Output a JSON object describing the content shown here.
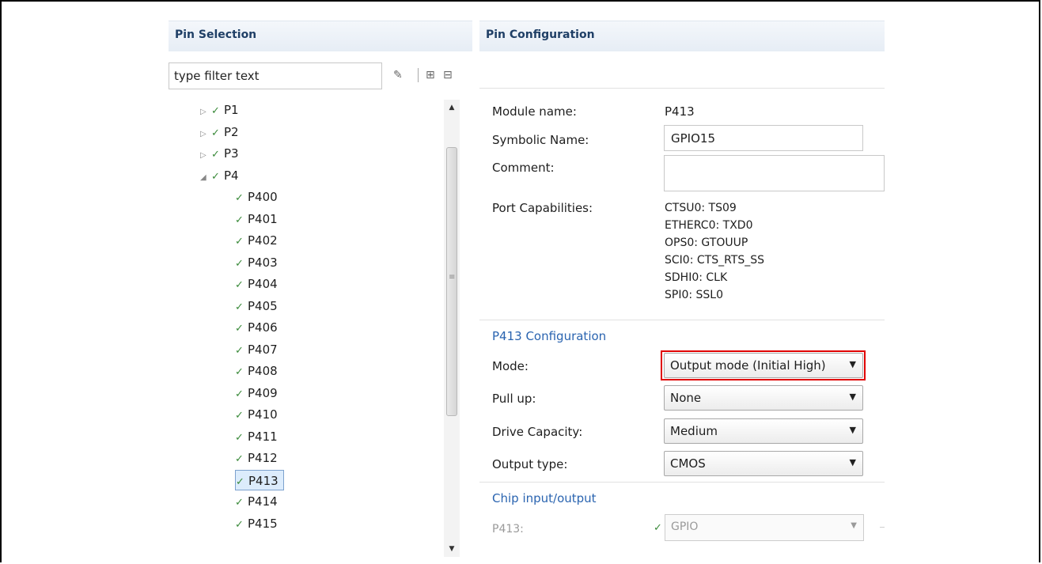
{
  "pin_selection": {
    "title": "Pin Selection",
    "filter_placeholder": "type filter text",
    "tree": [
      {
        "label": "P1",
        "expander": "▷",
        "checked": true
      },
      {
        "label": "P2",
        "expander": "▷",
        "checked": true
      },
      {
        "label": "P3",
        "expander": "▷",
        "checked": true
      },
      {
        "label": "P4",
        "expander": "◢",
        "checked": true
      },
      {
        "label": "P400",
        "checked": true
      },
      {
        "label": "P401",
        "checked": true
      },
      {
        "label": "P402",
        "checked": true
      },
      {
        "label": "P403",
        "checked": true
      },
      {
        "label": "P404",
        "checked": true
      },
      {
        "label": "P405",
        "checked": true
      },
      {
        "label": "P406",
        "checked": true
      },
      {
        "label": "P407",
        "checked": true
      },
      {
        "label": "P408",
        "checked": true
      },
      {
        "label": "P409",
        "checked": true
      },
      {
        "label": "P410",
        "checked": true
      },
      {
        "label": "P411",
        "checked": true
      },
      {
        "label": "P412",
        "checked": true
      },
      {
        "label": "P413",
        "checked": true,
        "selected": true
      },
      {
        "label": "P414",
        "checked": true
      },
      {
        "label": "P415",
        "checked": true
      }
    ]
  },
  "pin_configuration": {
    "title": "Pin Configuration",
    "module_name_label": "Module name:",
    "module_name_value": "P413",
    "symbolic_name_label": "Symbolic Name:",
    "symbolic_name_value": "GPIO15",
    "comment_label": "Comment:",
    "comment_value": "",
    "port_capabilities_label": "Port Capabilities:",
    "port_capabilities": [
      "CTSU0: TS09",
      "ETHERC0: TXD0",
      "OPS0: GTOUUP",
      "SCI0: CTS_RTS_SS",
      "SDHI0: CLK",
      "SPI0: SSL0"
    ],
    "config_section_title": "P413 Configuration",
    "mode_label": "Mode:",
    "mode_value": "Output mode (Initial High)",
    "pull_up_label": "Pull up:",
    "pull_up_value": "None",
    "drive_capacity_label": "Drive Capacity:",
    "drive_capacity_value": "Medium",
    "output_type_label": "Output type:",
    "output_type_value": "CMOS",
    "chip_io_title": "Chip input/output",
    "chip_io_pin_label": "P413:",
    "chip_io_pin_value": "GPIO"
  },
  "colors": {
    "highlight_border": "#e00000",
    "section_blue": "#2a64b0",
    "check_green": "#3a8a3a"
  }
}
